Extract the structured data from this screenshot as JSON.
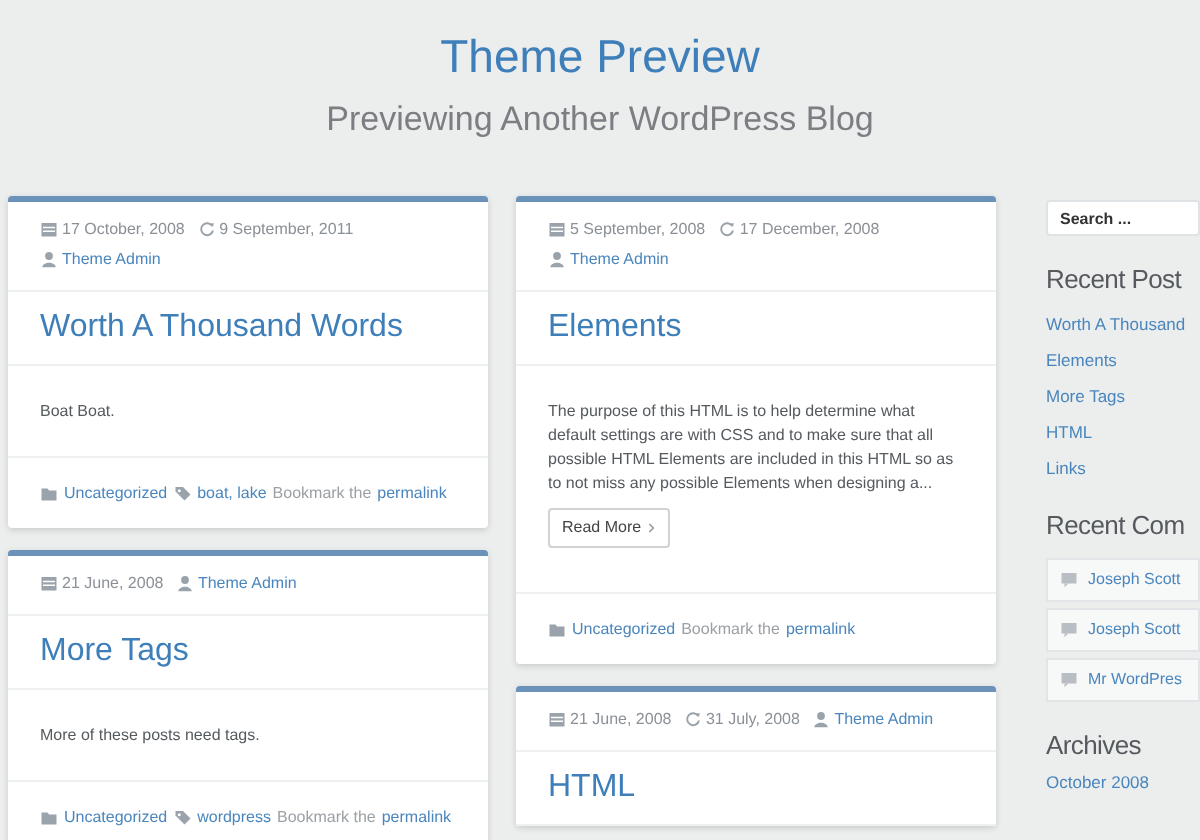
{
  "site": {
    "title": "Theme Preview",
    "tagline": "Previewing Another WordPress Blog"
  },
  "columns": [
    [
      {
        "date": "17 October, 2008",
        "updated": "9 September, 2011",
        "author": "Theme Admin",
        "title": "Worth A Thousand Words",
        "excerpt": "Boat Boat.",
        "category": "Uncategorized",
        "tags": "boat, lake",
        "bookmark": "Bookmark the",
        "permalink": "permalink"
      },
      {
        "date": "21 June, 2008",
        "author": "Theme Admin",
        "title": "More Tags",
        "excerpt": "More of these posts need tags.",
        "category": "Uncategorized",
        "tags": "wordpress",
        "bookmark": "Bookmark the",
        "permalink": "permalink"
      }
    ],
    [
      {
        "date": "5 September, 2008",
        "updated": "17 December, 2008",
        "author": "Theme Admin",
        "title": "Elements",
        "excerpt": "The purpose of this HTML is to help determine what default settings are with CSS and to make sure that all possible HTML Elements are included in this HTML so as to not miss any possible Elements when designing a...",
        "read_more": "Read More",
        "category": "Uncategorized",
        "bookmark": "Bookmark the",
        "permalink": "permalink"
      },
      {
        "date": "21 June, 2008",
        "updated": "31 July, 2008",
        "author": "Theme Admin",
        "title": "HTML"
      }
    ]
  ],
  "sidebar": {
    "search": {
      "placeholder": "Search ..."
    },
    "recent_posts": {
      "heading": "Recent Post",
      "items": [
        "Worth A Thousand",
        "Elements",
        "More Tags",
        "HTML",
        "Links"
      ]
    },
    "recent_comments": {
      "heading": "Recent Com",
      "items": [
        "Joseph Scott",
        "Joseph Scott",
        "Mr WordPres"
      ]
    },
    "archives": {
      "heading": "Archives",
      "items": [
        "October 2008"
      ]
    }
  }
}
